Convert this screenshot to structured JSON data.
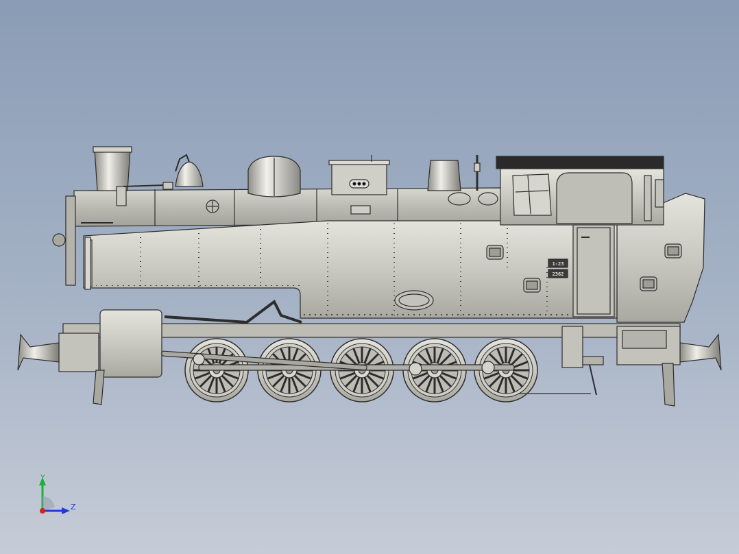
{
  "scene": {
    "background_top": "#8a9cb5",
    "background_bottom": "#c6ccd7",
    "model_fill": "#c9c8c1",
    "model_stroke": "#2d2d2d",
    "cab_roof_color": "#2a2a2a",
    "number_plate_top": "1-23",
    "number_plate_bottom": "2362"
  },
  "triad": {
    "y_label": "Y",
    "z_label": "Z",
    "y_color": "#1fae3a",
    "z_color": "#2338d8",
    "x_color": "#d42020"
  }
}
